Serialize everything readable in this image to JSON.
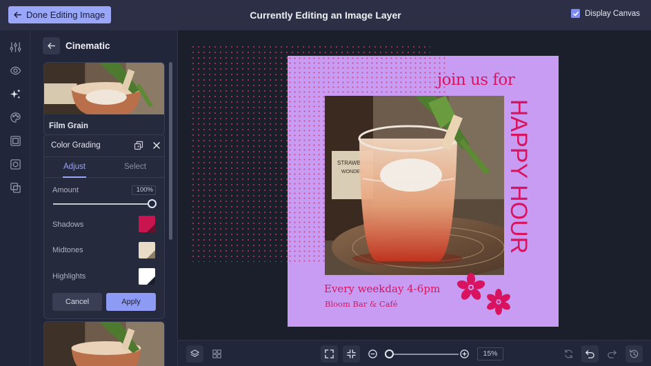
{
  "topbar": {
    "done_label": "Done Editing Image",
    "title": "Currently Editing an Image Layer",
    "display_canvas_label": "Display Canvas",
    "display_canvas_checked": true
  },
  "rail": {
    "icons": [
      "sliders-icon",
      "eye-icon",
      "sparkles-icon",
      "palette-icon",
      "frame-icon",
      "focus-icon",
      "layers-overlap-icon"
    ],
    "active": "sparkles-icon"
  },
  "panel": {
    "title": "Cinematic",
    "cards": [
      {
        "label": "Film Grain"
      },
      {
        "label": ""
      }
    ],
    "color_grading": {
      "title": "Color Grading",
      "tabs": [
        {
          "label": "Adjust",
          "active": true
        },
        {
          "label": "Select",
          "active": false
        }
      ],
      "amount_label": "Amount",
      "amount_value": "100%",
      "amount_fraction": 1.0,
      "shadows_label": "Shadows",
      "shadows_color": "#c8154f",
      "midtones_label": "Midtones",
      "midtones_color": "#e8dcc6",
      "highlights_label": "Highlights",
      "highlights_color": "#ffffff",
      "cancel_label": "Cancel",
      "apply_label": "Apply"
    }
  },
  "artboard": {
    "background": "#c89cf2",
    "accent": "#d8135f",
    "headline_small": "join us for",
    "headline_vertical": "HAPPY HOUR",
    "schedule": "Every weekday 4-6pm",
    "venue": "Bloom Bar & Café"
  },
  "bottombar": {
    "zoom_value": "15%"
  },
  "colors": {
    "accent": "#9aa6f7",
    "topbar": "#2c2f45",
    "panel": "#22263a",
    "canvas": "#1b1f2b"
  }
}
